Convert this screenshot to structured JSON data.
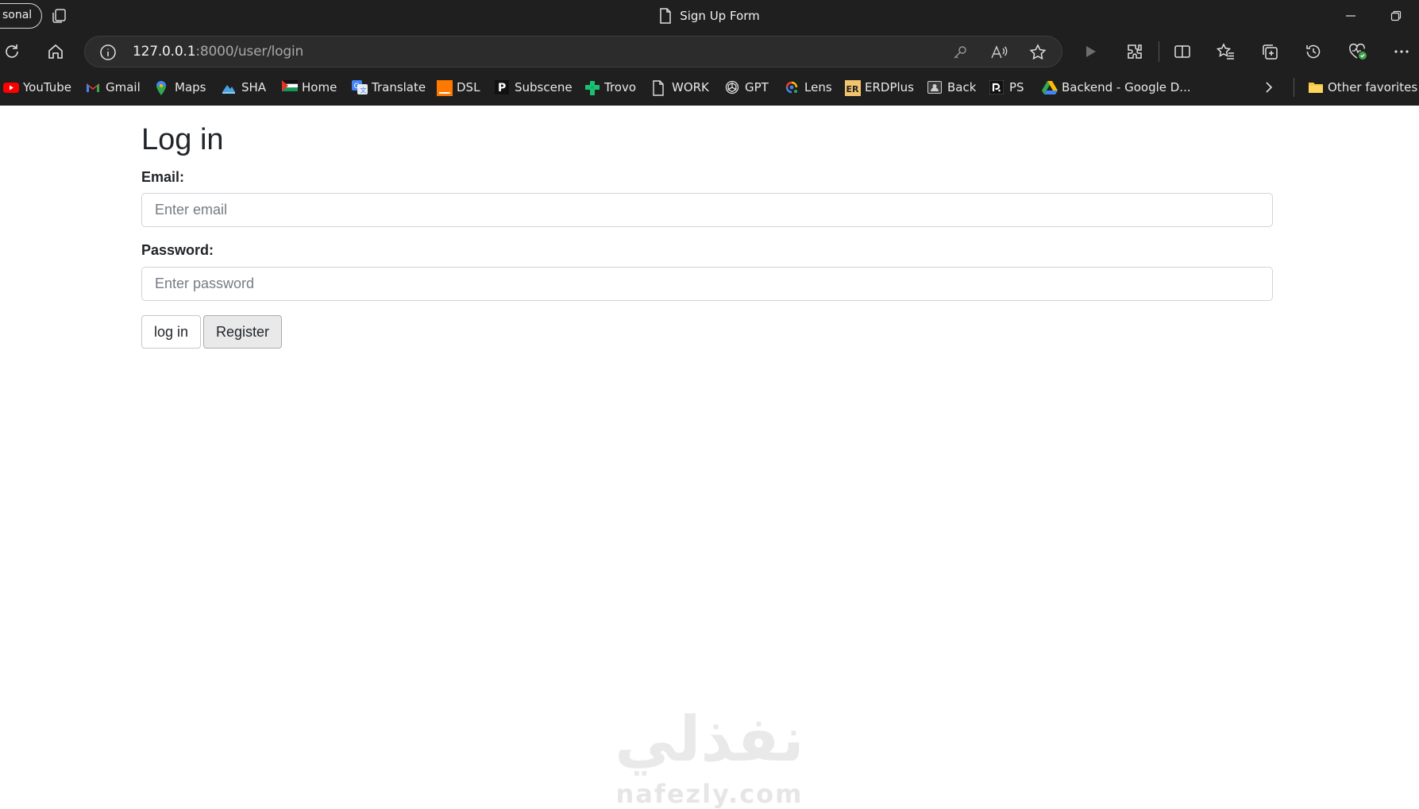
{
  "browser": {
    "profile_label": "sonal",
    "tab_title": "Sign Up Form",
    "url_host": "127.0.0.1",
    "url_rest": ":8000/user/login"
  },
  "bookmarks": [
    {
      "label": "YouTube",
      "icon": "youtube-icon",
      "color": "#ff0000"
    },
    {
      "label": "Gmail",
      "icon": "gmail-icon",
      "color": "#ea4335"
    },
    {
      "label": "Maps",
      "icon": "maps-icon",
      "color": "#34a853"
    },
    {
      "label": "SHA",
      "icon": "sha-icon",
      "color": "#4aa3df"
    },
    {
      "label": "Home",
      "icon": "flag-icon",
      "color": "#d32f2f"
    },
    {
      "label": "Translate",
      "icon": "translate-icon",
      "color": "#4285f4"
    },
    {
      "label": "DSL",
      "icon": "dsl-icon",
      "color": "#ff7900"
    },
    {
      "label": "Subscene",
      "icon": "subscene-icon",
      "color": "#111111"
    },
    {
      "label": "Trovo",
      "icon": "trovo-icon",
      "color": "#1dbf73"
    },
    {
      "label": "WORK",
      "icon": "page-icon",
      "color": "#e0e0e0"
    },
    {
      "label": "GPT",
      "icon": "openai-icon",
      "color": "#e0e0e0"
    },
    {
      "label": "Lens",
      "icon": "lens-icon",
      "color": "#4285f4"
    },
    {
      "label": "ERDPlus",
      "icon": "erdplus-icon",
      "color": "#f2c46d"
    },
    {
      "label": "Back",
      "icon": "contact-icon",
      "color": "#cfcfcf"
    },
    {
      "label": "PS",
      "icon": "ps-icon",
      "color": "#111111"
    },
    {
      "label": "Backend - Google D...",
      "icon": "google-drive-icon",
      "color": "#fbbc04"
    }
  ],
  "other_favorites": "Other favorites",
  "form": {
    "title": "Log in",
    "email_label": "Email:",
    "email_placeholder": "Enter email",
    "password_label": "Password:",
    "password_placeholder": "Enter password",
    "login_button": "log in",
    "register_button": "Register"
  },
  "watermark": {
    "arabic": "نفذلي",
    "latin": "nafezly.com"
  }
}
